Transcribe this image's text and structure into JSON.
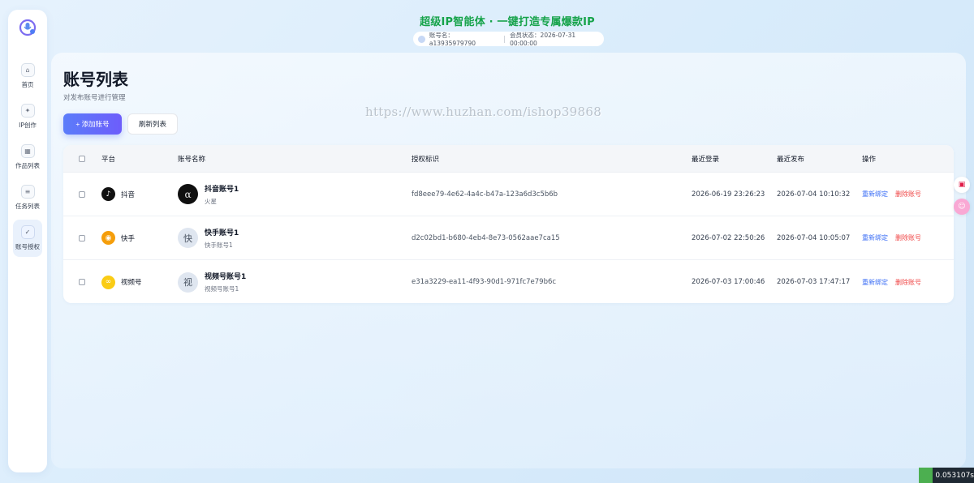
{
  "header": {
    "title": "超级IP智能体 · 一键打造专属爆款IP",
    "account_label": "账号名：a13935979790",
    "member_label": "会员状态：2026-07-31 00:00:00"
  },
  "sidebar": {
    "items": [
      {
        "label": "首页",
        "icon": "home-icon",
        "glyph": "⌂"
      },
      {
        "label": "IP创作",
        "icon": "sparkle-icon",
        "glyph": "✦"
      },
      {
        "label": "作品列表",
        "icon": "grid-icon",
        "glyph": "▦"
      },
      {
        "label": "任务列表",
        "icon": "list-icon",
        "glyph": "≡"
      },
      {
        "label": "账号授权",
        "icon": "check-icon",
        "glyph": "✓"
      }
    ],
    "active_index": 4
  },
  "page": {
    "title": "账号列表",
    "subtitle": "对发布账号进行管理",
    "add_button": "+ 添加账号",
    "refresh_button": "刷新列表",
    "watermark": "https://www.huzhan.com/ishop39868"
  },
  "table": {
    "columns": [
      "平台",
      "账号名称",
      "授权标识",
      "最近登录",
      "最近发布",
      "操作"
    ],
    "rows": [
      {
        "platform": "抖音",
        "platform_icon": "douyin-icon",
        "name": "抖音账号1",
        "sub": "火星",
        "avatar": "α",
        "auth_id": "fd8eee79-4e62-4a4c-b47a-123a6d3c5b6b",
        "last_login": "2026-06-19 23:26:23",
        "last_publish": "2026-07-04 10:10:32",
        "op_rebind": "重新绑定",
        "op_delete": "删除账号"
      },
      {
        "platform": "快手",
        "platform_icon": "kuaishou-icon",
        "name": "快手账号1",
        "sub": "快手账号1",
        "avatar": "快",
        "auth_id": "d2c02bd1-b680-4eb4-8e73-0562aae7ca15",
        "last_login": "2026-07-02 22:50:26",
        "last_publish": "2026-07-04 10:05:07",
        "op_rebind": "重新绑定",
        "op_delete": "删除账号"
      },
      {
        "platform": "视频号",
        "platform_icon": "shipinhao-icon",
        "name": "视频号账号1",
        "sub": "视频号账号1",
        "avatar": "视",
        "auth_id": "e31a3229-ea11-4f93-90d1-971fc7e79b6c",
        "last_login": "2026-07-03 17:00:46",
        "last_publish": "2026-07-03 17:47:17",
        "op_rebind": "重新绑定",
        "op_delete": "删除账号"
      }
    ]
  },
  "timer": "0.053107s",
  "colors": {
    "accent": "#5b7cfa",
    "title_green": "#16a34a",
    "link_blue": "#3b6ef5",
    "danger_red": "#ef4444"
  }
}
